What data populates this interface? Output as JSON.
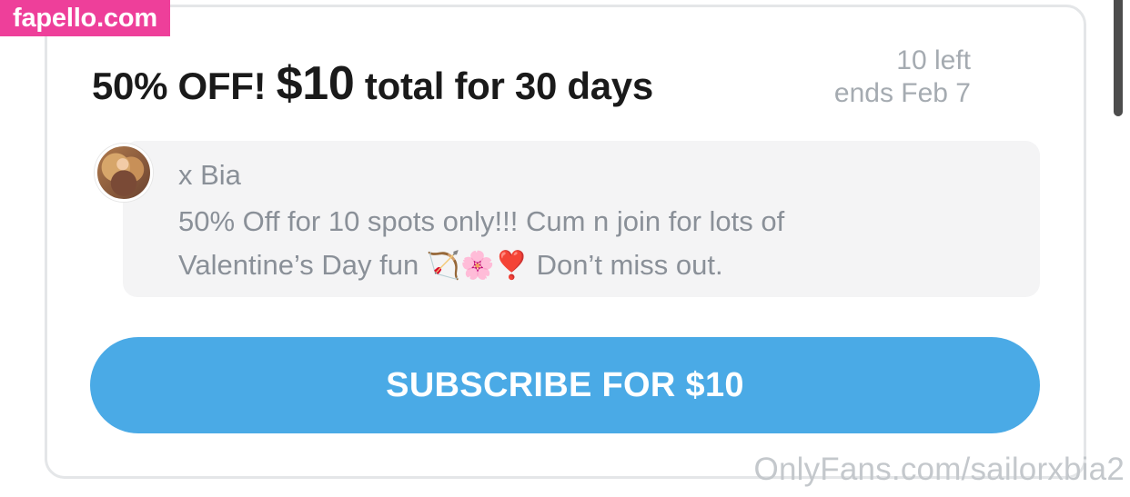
{
  "watermark": {
    "site": "fapello.com",
    "url": "OnlyFans.com/sailorxbia2"
  },
  "offer": {
    "title_prefix": "50% OFF!",
    "title_price": "$10",
    "title_suffix": "total for 30 days",
    "spots_left": "10 left",
    "ends": "ends Feb 7"
  },
  "message": {
    "sender": "x Bia",
    "text_line1": "50% Off for 10 spots only!!! Cum n join for lots of",
    "text_line2_start": "Valentine’s Day fun",
    "emojis": "🏹🌸❣️",
    "text_line2_end": "Don’t miss out."
  },
  "subscribe": {
    "label": "SUBSCRIBE FOR $10"
  },
  "colors": {
    "button": "#4aaae6",
    "badge": "#ee3f9a"
  }
}
